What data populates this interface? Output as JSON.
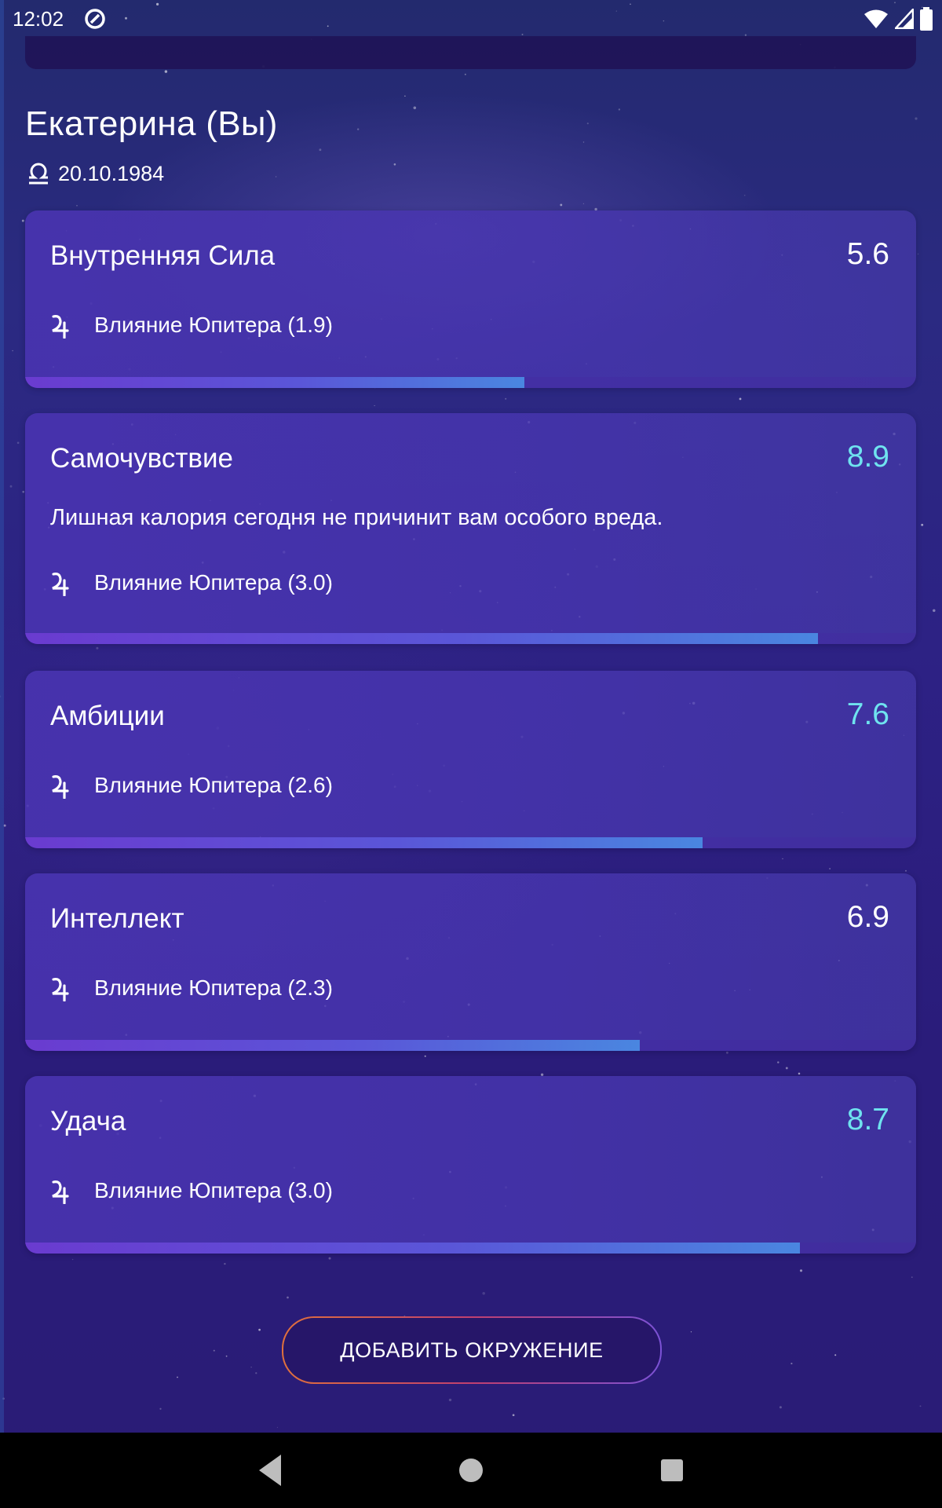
{
  "status": {
    "time": "12:02"
  },
  "profile": {
    "name": "Екатерина (Вы)",
    "birth_date": "20.10.1984",
    "zodiac_icon": "libra-icon"
  },
  "cards": [
    {
      "title": "Внутренняя Сила",
      "score": "5.6",
      "influence": "Влияние Юпитера (1.9)",
      "progress": 0.56,
      "highlight": false
    },
    {
      "title": "Самочувствие",
      "score": "8.9",
      "description": "Лишная калория сегодня не причинит вам особого вреда.",
      "influence": "Влияние Юпитера (3.0)",
      "progress": 0.89,
      "highlight": true
    },
    {
      "title": "Амбиции",
      "score": "7.6",
      "influence": "Влияние Юпитера (2.6)",
      "progress": 0.76,
      "highlight": true
    },
    {
      "title": "Интеллект",
      "score": "6.9",
      "influence": "Влияние Юпитера (2.3)",
      "progress": 0.69,
      "highlight": false
    },
    {
      "title": "Удача",
      "score": "8.7",
      "influence": "Влияние Юпитера (3.0)",
      "progress": 0.87,
      "highlight": true
    }
  ],
  "actions": {
    "add_label": "ДОБАВИТЬ ОКРУЖЕНИЕ"
  },
  "colors": {
    "highlight_score": "#6fe3ef",
    "background": "#2b2180",
    "button_border": "#e0703c"
  }
}
